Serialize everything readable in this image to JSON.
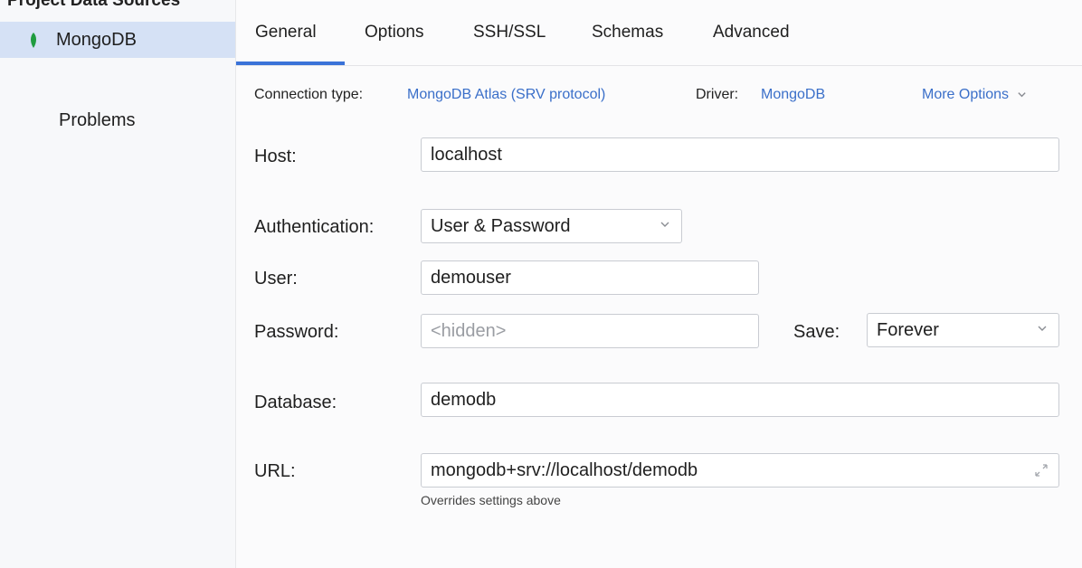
{
  "sidebar": {
    "title": "Project Data Sources",
    "items": [
      {
        "label": "MongoDB",
        "icon": "mongodb-leaf-icon"
      }
    ],
    "problems_label": "Problems"
  },
  "tabs": [
    {
      "label": "General",
      "active": true
    },
    {
      "label": "Options"
    },
    {
      "label": "SSH/SSL"
    },
    {
      "label": "Schemas"
    },
    {
      "label": "Advanced"
    }
  ],
  "connection": {
    "type_label": "Connection type:",
    "type_value": "MongoDB Atlas (SRV protocol)",
    "driver_label": "Driver:",
    "driver_value": "MongoDB",
    "more_options": "More Options"
  },
  "form": {
    "host_label": "Host:",
    "host_value": "localhost",
    "auth_label": "Authentication:",
    "auth_value": "User & Password",
    "user_label": "User:",
    "user_value": "demouser",
    "password_label": "Password:",
    "password_placeholder": "<hidden>",
    "save_label": "Save:",
    "save_value": "Forever",
    "database_label": "Database:",
    "database_value": "demodb",
    "url_label": "URL:",
    "url_value": "mongodb+srv://localhost/demodb",
    "url_hint": "Overrides settings above"
  },
  "colors": {
    "accent": "#3a72d8",
    "selection": "#d5e1f5",
    "link": "#3a6fc9",
    "mongo_green": "#1f9c3f"
  }
}
